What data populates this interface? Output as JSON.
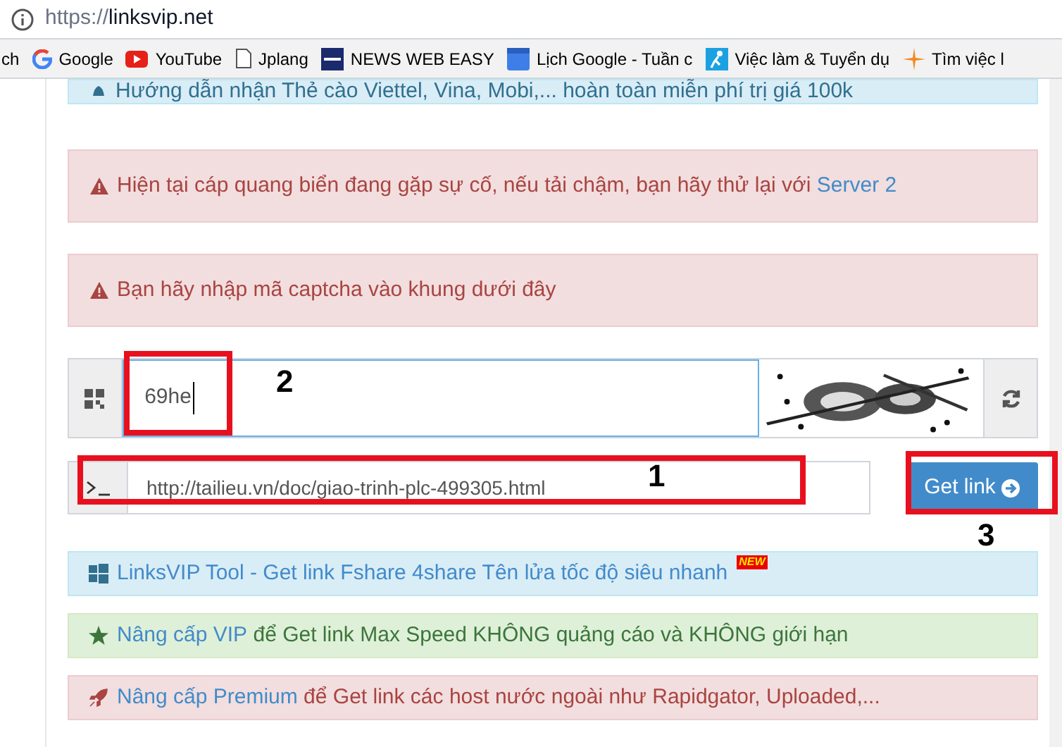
{
  "browser": {
    "url_scheme": "https://",
    "url_host": "linksvip.net",
    "bookmarks": [
      {
        "kind": "cut",
        "label": "ch"
      },
      {
        "kind": "google",
        "label": "Google"
      },
      {
        "kind": "youtube",
        "label": "YouTube"
      },
      {
        "kind": "page",
        "label": "Jplang"
      },
      {
        "kind": "nhk",
        "label": "NEWS WEB EASY"
      },
      {
        "kind": "calendar",
        "label": "Lịch Google - Tuần c"
      },
      {
        "kind": "person",
        "label": "Việc làm & Tuyển dụ"
      },
      {
        "kind": "burst",
        "label": "Tìm việc l"
      }
    ]
  },
  "alerts": [
    {
      "kind": "info",
      "text": "Hướng dẫn nhận Thẻ cào Viettel, Vina, Mobi,... hoàn toàn miễn phí trị giá 100k"
    },
    {
      "kind": "danger",
      "text": "Hiện tại cáp quang biển đang gặp sự cố, nếu tải chậm, bạn hãy thử lại với ",
      "link": "Server 2"
    },
    {
      "kind": "danger",
      "text": "Bạn hãy nhập mã captcha vào khung dưới đây"
    }
  ],
  "captcha": {
    "value": "69he"
  },
  "url_field": {
    "value": "http://tailieu.vn/doc/giao-trinh-plc-499305.html"
  },
  "get_link_button": "Get link",
  "notices": [
    {
      "kind": "info",
      "link": "LinksVIP Tool - Get link Fshare 4share Tên lửa tốc độ siêu nhanh",
      "badge": "NEW"
    },
    {
      "kind": "success",
      "link": "Nâng cấp VIP",
      "text": " để Get link Max Speed KHÔNG quảng cáo và KHÔNG giới hạn"
    },
    {
      "kind": "danger",
      "link": "Nâng cấp Premium",
      "text": " để Get link các host nước ngoài như Rapidgator, Uploaded,..."
    }
  ],
  "annotations": [
    {
      "label": "2"
    },
    {
      "label": "1"
    },
    {
      "label": "3"
    }
  ]
}
